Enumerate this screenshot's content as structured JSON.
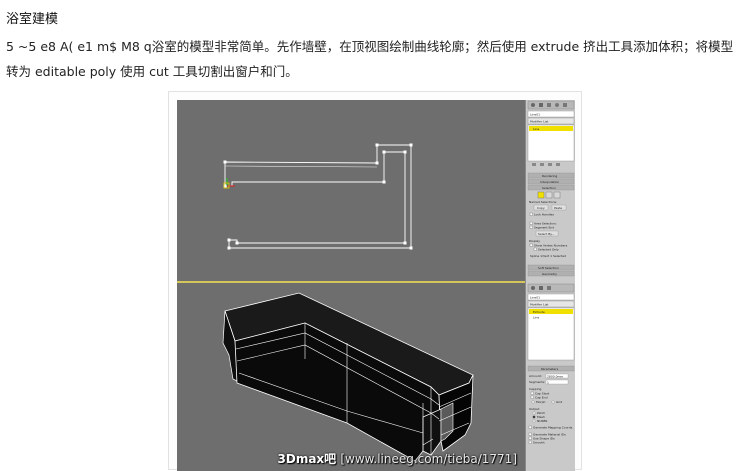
{
  "heading": "浴室建模",
  "paragraph": "5 ~5 e8 A( e1 m$ M8 q浴室的模型非常简单。先作墙壁，在顶视图绘制曲线轮廓；然后使用 extrude 挤出工具添加体积；将模型转为 editable poly 使用 cut 工具切割出窗户和门。",
  "screenshot": {
    "panel_top": {
      "object_name": "Line01",
      "modifier_list": "Modifier List",
      "stack_item": "Line",
      "rollouts": [
        "Rendering",
        "Interpolation",
        "Selection"
      ],
      "named_selections": "Named Selections:",
      "copy": "Copy",
      "paste": "Paste",
      "lock_handles": "Lock Handles",
      "area_selection": "Area Selection:",
      "segment_end": "Segment End",
      "select_by": "Select By...",
      "display": "Display",
      "show_vertex_numbers": "Show Vertex Numbers",
      "selected_only": "Selected Only",
      "status": "Spline 1/Vert 1 Selected",
      "soft_selection": "Soft Selection",
      "geometry": "Geometry"
    },
    "panel_bottom": {
      "object_name": "Line01",
      "modifier_list": "Modifier List",
      "stack_item_1": "Extrude",
      "stack_item_2": "Line",
      "parameters": "Parameters",
      "amount_label": "Amount:",
      "amount_value": "2800.0mm",
      "segments_label": "Segments:",
      "segments_value": "1",
      "capping": "Capping",
      "cap_start": "Cap Start",
      "cap_end": "Cap End",
      "morph": "Morph",
      "grid": "Grid",
      "output": "Output",
      "patch": "Patch",
      "mesh": "Mesh",
      "nurbs": "NURBS",
      "gen_mapping": "Generate Mapping Coords.",
      "gen_material": "Generate Material IDs",
      "use_shape_ids": "Use Shape IDs",
      "smooth": "Smooth"
    },
    "watermark_brand": "3Dmax吧",
    "watermark_url": "[www.lineeg.com/tieba/1771]"
  },
  "colors": {
    "viewport": "#6e6e6e",
    "viewport_divider": "#d4c65a",
    "spline": "#ffffff",
    "panel": "#c9c9c9",
    "selected_item": "#f0e000",
    "mesh_face": "#0a0a0a"
  }
}
